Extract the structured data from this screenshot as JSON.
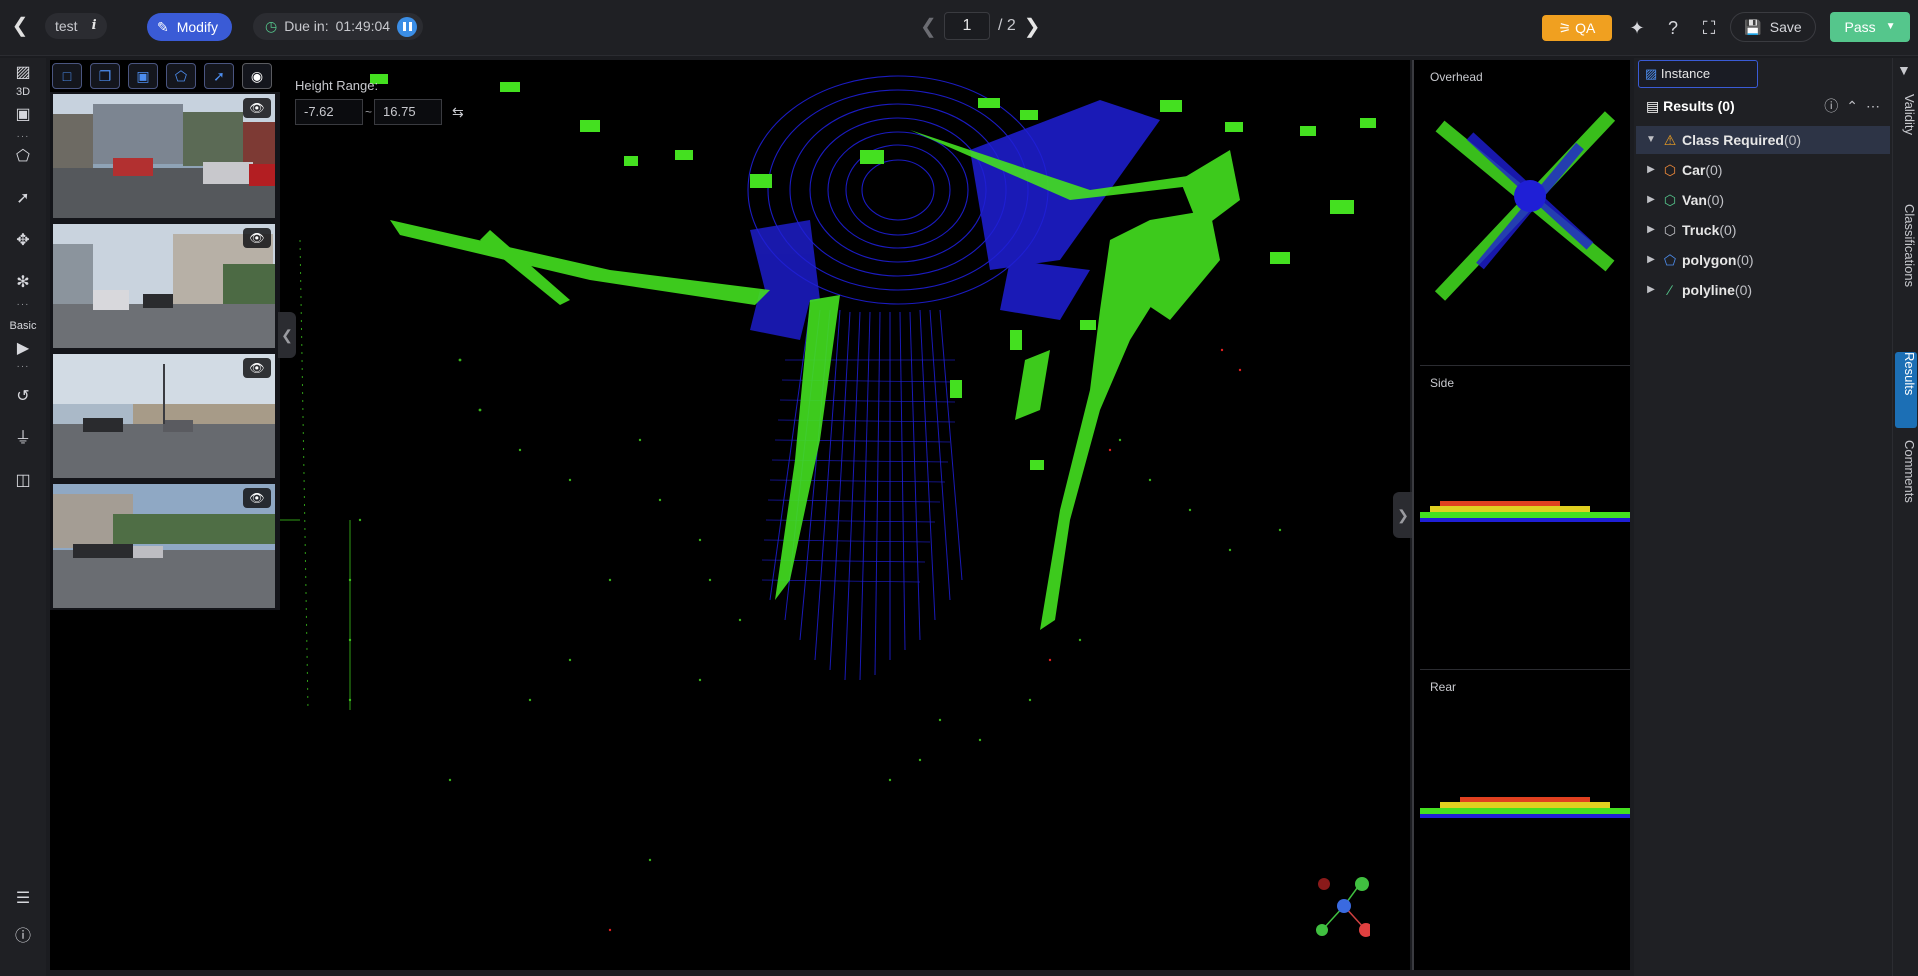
{
  "topbar": {
    "task_name": "test",
    "info_glyph": "i",
    "mode_label": "Modify",
    "due_label": "Due in:",
    "due_time": "01:49:04",
    "page_current": "1",
    "page_total": "/ 2",
    "qa_label": "QA",
    "save_label": "Save",
    "pass_label": "Pass"
  },
  "leftbar": {
    "section_3d": "3D",
    "section_basic": "Basic"
  },
  "viewport": {
    "height_range_label": "Height Range:",
    "height_min": "-7.62",
    "height_sep": "~",
    "height_max": "16.75"
  },
  "views": {
    "overhead": "Overhead",
    "side": "Side",
    "rear": "Rear"
  },
  "results": {
    "instance_tab": "Instance",
    "header": "Results (0)",
    "rows": [
      {
        "name": "Class Required",
        "count": "(0)",
        "icon": "warning-icon",
        "color": "#f0a020"
      },
      {
        "name": "Car",
        "count": "(0)",
        "icon": "cuboid-icon",
        "color": "#f08a3a"
      },
      {
        "name": "Van",
        "count": "(0)",
        "icon": "cuboid-icon",
        "color": "#55c68c"
      },
      {
        "name": "Truck",
        "count": "(0)",
        "icon": "cuboid-icon",
        "color": "#bfc0c5"
      },
      {
        "name": "polygon",
        "count": "(0)",
        "icon": "polygon-icon",
        "color": "#4d8ef0"
      },
      {
        "name": "polyline",
        "count": "(0)",
        "icon": "polyline-icon",
        "color": "#55c68c"
      }
    ]
  },
  "sidetabs": [
    "Validity",
    "Classifications",
    "Results",
    "Comments"
  ],
  "colors": {
    "accent": "#3a5bd6",
    "pass": "#55c68c",
    "qa": "#f0a020",
    "points_near": "#2020d0",
    "points_far": "#40e020"
  }
}
